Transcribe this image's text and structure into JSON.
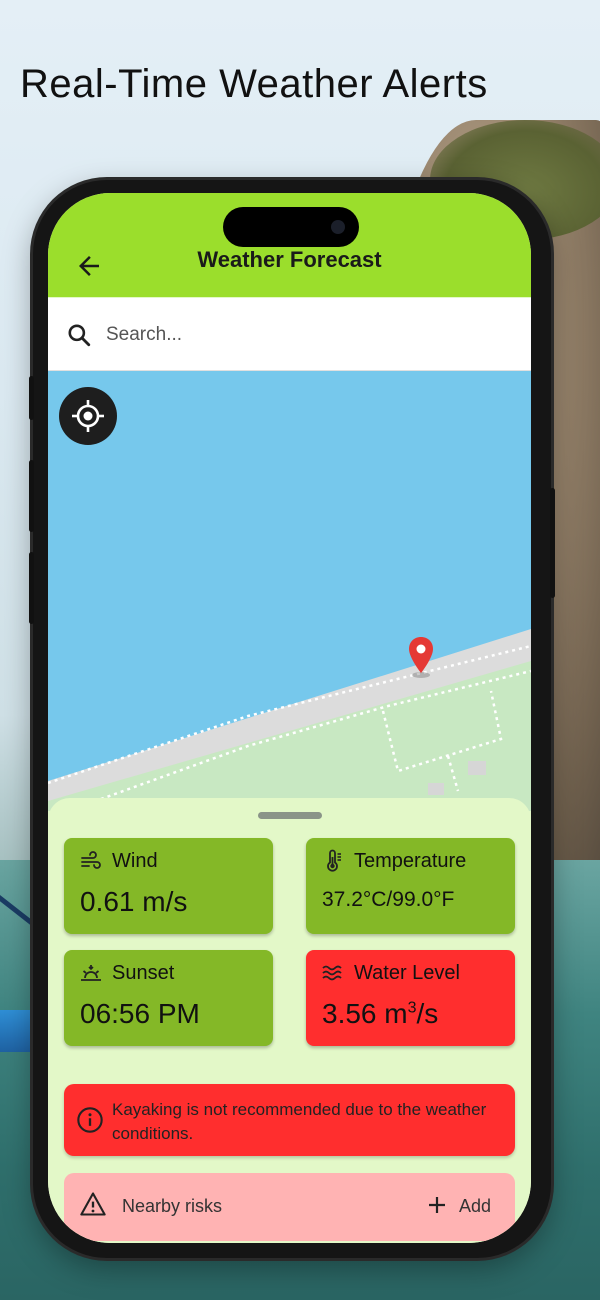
{
  "headline": "Real-Time Weather Alerts",
  "appbar": {
    "title": "Weather Forecast",
    "back_icon": "arrow-left-icon"
  },
  "search": {
    "placeholder": "Search...",
    "value": "",
    "icon": "search-icon"
  },
  "map": {
    "locate_icon": "crosshair-icon",
    "pin_icon": "map-pin-icon",
    "water_color": "#76c8ec",
    "land_color": "#c8e8c2"
  },
  "cards": {
    "wind": {
      "label": "Wind",
      "value": "0.61 m/s",
      "icon": "wind-icon"
    },
    "temperature": {
      "label": "Temperature",
      "value": "37.2°C/99.0°F",
      "icon": "thermometer-icon"
    },
    "sunset": {
      "label": "Sunset",
      "value": "06:56 PM",
      "icon": "sunset-icon"
    },
    "water_level": {
      "label": "Water Level",
      "value": "3.56 m",
      "unit_exponent": "3",
      "unit_suffix": "/s",
      "icon": "waves-icon"
    }
  },
  "alert": {
    "text": "Kayaking is not recommended due to the weather conditions.",
    "icon": "info-icon"
  },
  "risks": {
    "label": "Nearby risks",
    "add_label": "Add",
    "icon": "warning-icon",
    "add_icon": "plus-icon"
  },
  "colors": {
    "accent": "#9bde2c",
    "ok": "#84b827",
    "danger": "#ff2e2e",
    "sheet": "#e3f8c8",
    "risk_bg": "#ffb3b3"
  }
}
